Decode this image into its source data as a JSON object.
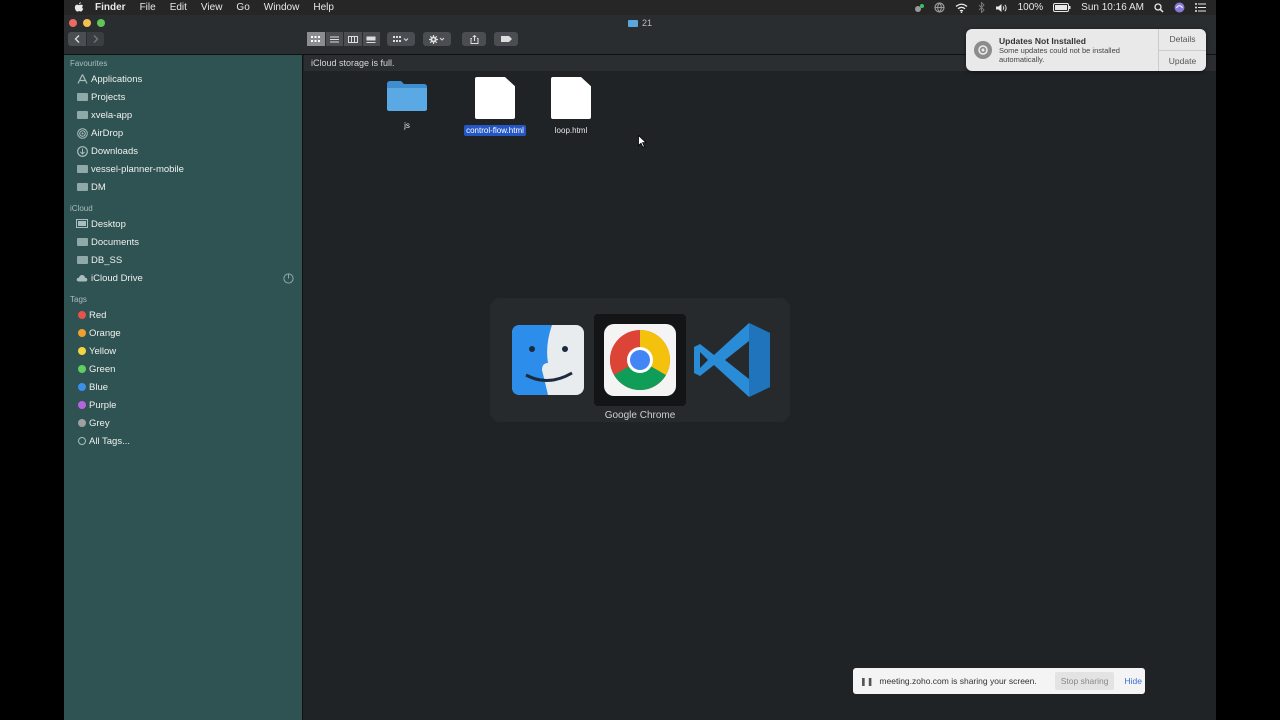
{
  "menubar": {
    "app": "Finder",
    "items": [
      "File",
      "Edit",
      "View",
      "Go",
      "Window",
      "Help"
    ],
    "battery": "100%",
    "clock": "Sun 10:16 AM"
  },
  "window": {
    "title": "21"
  },
  "sidebar": {
    "favourites_header": "Favourites",
    "favourites": [
      "Applications",
      "Projects",
      "xvela-app",
      "AirDrop",
      "Downloads",
      "vessel-planner-mobile",
      "DM"
    ],
    "icloud_header": "iCloud",
    "icloud": [
      "Desktop",
      "Documents",
      "DB_SS",
      "iCloud Drive"
    ],
    "tags_header": "Tags",
    "tags": [
      {
        "label": "Red",
        "color": "#e5534b"
      },
      {
        "label": "Orange",
        "color": "#f0a030"
      },
      {
        "label": "Yellow",
        "color": "#f5d442"
      },
      {
        "label": "Green",
        "color": "#5fcf5f"
      },
      {
        "label": "Blue",
        "color": "#3b8eea"
      },
      {
        "label": "Purple",
        "color": "#b763e0"
      },
      {
        "label": "Grey",
        "color": "#a0a0a0"
      },
      {
        "label": "All Tags...",
        "color": ""
      }
    ]
  },
  "content": {
    "path_message": "iCloud storage is full.",
    "files": [
      {
        "name": "js",
        "kind": "folder"
      },
      {
        "name": "control-flow.html",
        "kind": "document",
        "selected": true
      },
      {
        "name": "loop.html",
        "kind": "document"
      }
    ]
  },
  "switcher": {
    "apps": [
      "Finder",
      "Google Chrome",
      "Visual Studio Code"
    ],
    "selected_label": "Google Chrome"
  },
  "notification": {
    "title": "Updates Not Installed",
    "message": "Some updates could not be installed automatically.",
    "details_button": "Details",
    "update_button": "Update"
  },
  "screen_share": {
    "message": "meeting.zoho.com is sharing your screen.",
    "stop_button": "Stop sharing",
    "hide_button": "Hide"
  }
}
